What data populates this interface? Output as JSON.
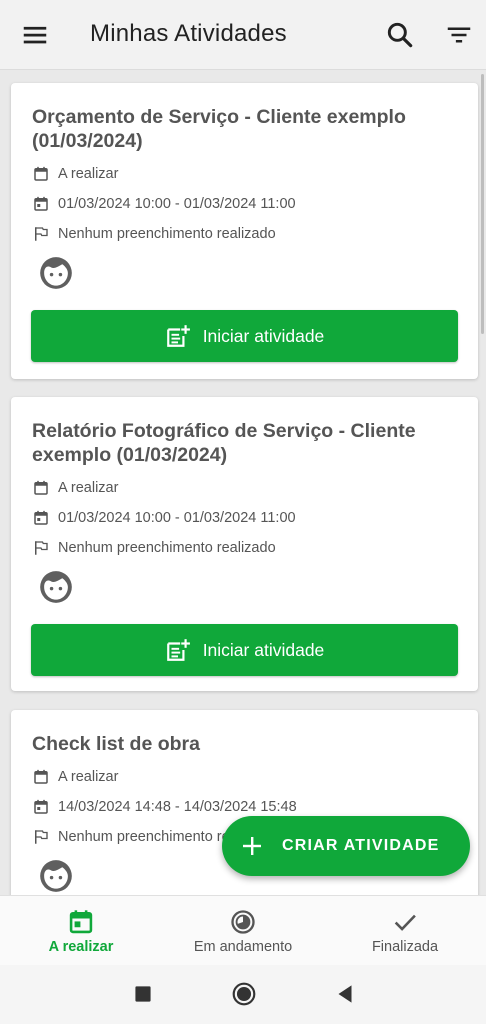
{
  "appbar": {
    "title": "Minhas Atividades",
    "icons": [
      "menu-icon",
      "search-icon",
      "filter-icon"
    ]
  },
  "cards": [
    {
      "title": "Orçamento de Serviço  - Cliente exemplo (01/03/2024)",
      "status": "A realizar",
      "datetime": "01/03/2024 10:00 - 01/03/2024 11:00",
      "fill_status": "Nenhum preenchimento realizado",
      "button": "Iniciar atividade"
    },
    {
      "title": "Relatório Fotográfico de Serviço - Cliente exemplo (01/03/2024)",
      "status": "A realizar",
      "datetime": "01/03/2024 10:00 - 01/03/2024 11:00",
      "fill_status": "Nenhum preenchimento realizado",
      "button": "Iniciar atividade"
    },
    {
      "title": "Check list de obra",
      "status": "A realizar",
      "datetime": "14/03/2024 14:48 - 14/03/2024 15:48",
      "fill_status": "Nenhum preenchimento realizado"
    }
  ],
  "fab": {
    "label": "CRIAR ATIVIDADE"
  },
  "bottom_nav": [
    {
      "label": "A realizar",
      "active": true,
      "icon": "calendar-today-icon"
    },
    {
      "label": "Em andamento",
      "active": false,
      "icon": "progress-clock-icon"
    },
    {
      "label": "Finalizada",
      "active": false,
      "icon": "check-icon"
    }
  ],
  "colors": {
    "accent": "#10a83a",
    "text": "#555555",
    "appbar_bg": "#f2f2f2"
  }
}
